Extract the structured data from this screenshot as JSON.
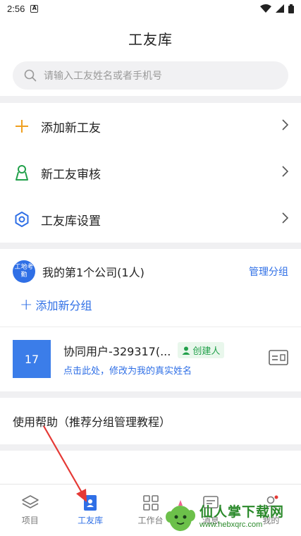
{
  "status_bar": {
    "time": "2:56",
    "notification_badge": "A"
  },
  "header": {
    "title": "工友库"
  },
  "search": {
    "placeholder": "请输入工友姓名或者手机号"
  },
  "menu": [
    {
      "label": "添加新工友",
      "icon": "plus-icon",
      "color": "#f0a020"
    },
    {
      "label": "新工友审核",
      "icon": "person-icon",
      "color": "#21a04a"
    },
    {
      "label": "工友库设置",
      "icon": "gear-icon",
      "color": "#2f6fe6"
    }
  ],
  "company": {
    "logo_text": "工地考勤",
    "name": "我的第1个公司(1人)",
    "manage_label": "管理分组",
    "add_group_label": "添加新分组"
  },
  "user": {
    "avatar_text": "17",
    "name": "协同用户-329317(...",
    "badge": "创建人",
    "hint": "点击此处，修改为我的真实姓名"
  },
  "help": {
    "label": "使用帮助（推荐分组管理教程）"
  },
  "tabs": [
    {
      "label": "项目",
      "icon": "layers-icon",
      "active": false
    },
    {
      "label": "工友库",
      "icon": "contacts-icon",
      "active": true
    },
    {
      "label": "工作台",
      "icon": "grid-icon",
      "active": false
    },
    {
      "label": "消息",
      "icon": "message-icon",
      "active": false
    },
    {
      "label": "我的",
      "icon": "user-icon",
      "active": false
    }
  ],
  "watermark": {
    "title": "仙人掌下载网",
    "url": "www.hebxqrc.com"
  },
  "colors": {
    "accent": "#2f6fe6",
    "green": "#21a04a",
    "orange": "#f0a020",
    "annotation": "#e53935"
  }
}
